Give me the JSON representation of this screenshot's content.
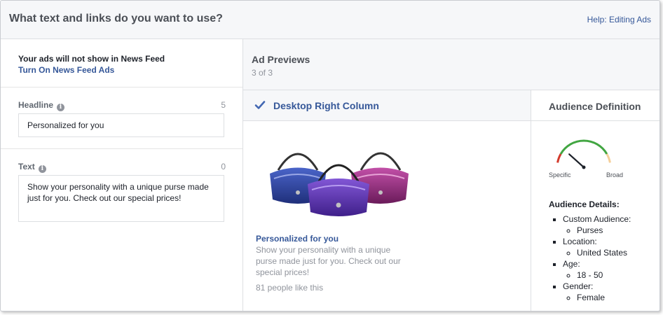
{
  "header": {
    "title": "What text and links do you want to use?",
    "help_link": "Help: Editing Ads"
  },
  "news_feed": {
    "notice": "Your ads will not show in News Feed",
    "link": "Turn On News Feed Ads"
  },
  "headline": {
    "label": "Headline",
    "count": "5",
    "value": "Personalized for you"
  },
  "text": {
    "label": "Text",
    "count": "0",
    "value": "Show your personality with a unique purse made just for you. Check out our special prices!"
  },
  "previews": {
    "title": "Ad Previews",
    "counter": "3 of 3"
  },
  "placement": {
    "title": "Desktop Right Column"
  },
  "ad": {
    "headline": "Personalized for you",
    "body": "Show your personality with a unique purse made just for you. Check out our special prices!",
    "likes": "81 people like this"
  },
  "audience": {
    "title": "Audience Definition",
    "gauge": {
      "left_label": "Specific",
      "right_label": "Broad",
      "level": 0.2
    },
    "details_title": "Audience Details:",
    "items": [
      {
        "label": "Custom Audience:",
        "value": "Purses"
      },
      {
        "label": "Location:",
        "value": "United States"
      },
      {
        "label": "Age:",
        "value": "18 - 50"
      },
      {
        "label": "Gender:",
        "value": "Female"
      }
    ]
  },
  "colors": {
    "link": "#365899",
    "gauge_green": "#42a642",
    "gauge_red": "#d33a2c",
    "gauge_tan": "#f5cf9a"
  }
}
